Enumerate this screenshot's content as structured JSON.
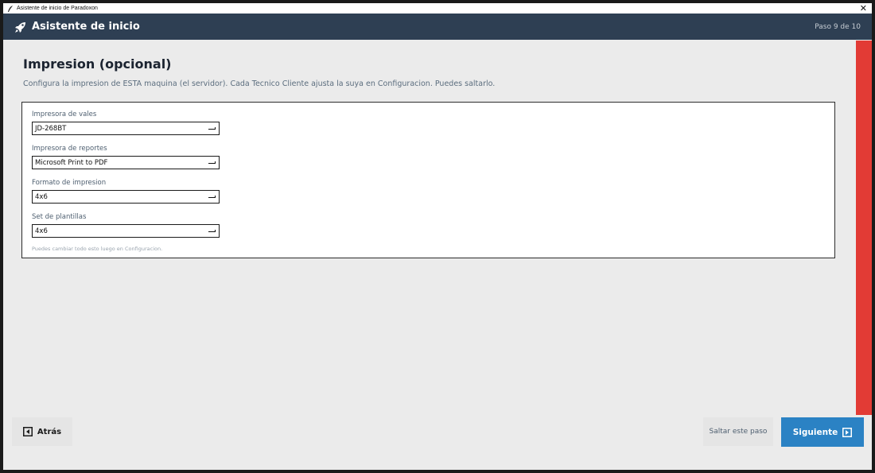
{
  "window": {
    "title": "Asistente de inicio de Paradoxon",
    "close_glyph": "✕"
  },
  "header": {
    "title": "Asistente de inicio",
    "step": "Paso 9 de 10",
    "icon": "rocket-icon"
  },
  "page": {
    "title": "Impresion (opcional)",
    "subtitle": "Configura la impresion de ESTA maquina (el servidor). Cada Tecnico Cliente ajusta la suya en Configuracion. Puedes saltarlo."
  },
  "form": {
    "fields": [
      {
        "label": "Impresora de vales",
        "value": "JD-268BT"
      },
      {
        "label": "Impresora de reportes",
        "value": "Microsoft Print to PDF"
      },
      {
        "label": "Formato de impresion",
        "value": "4x6"
      },
      {
        "label": "Set de plantillas",
        "value": "4x6"
      }
    ],
    "hint": "Puedes cambiar todo esto luego en Configuracion."
  },
  "footer": {
    "back_label": "Atrás",
    "skip_label": "Saltar este paso",
    "next_label": "Siguiente"
  },
  "colors": {
    "header_bg": "#2e3f53",
    "accent": "#2b82c4",
    "side_bar": "#e23b35",
    "background": "#ebebeb"
  }
}
